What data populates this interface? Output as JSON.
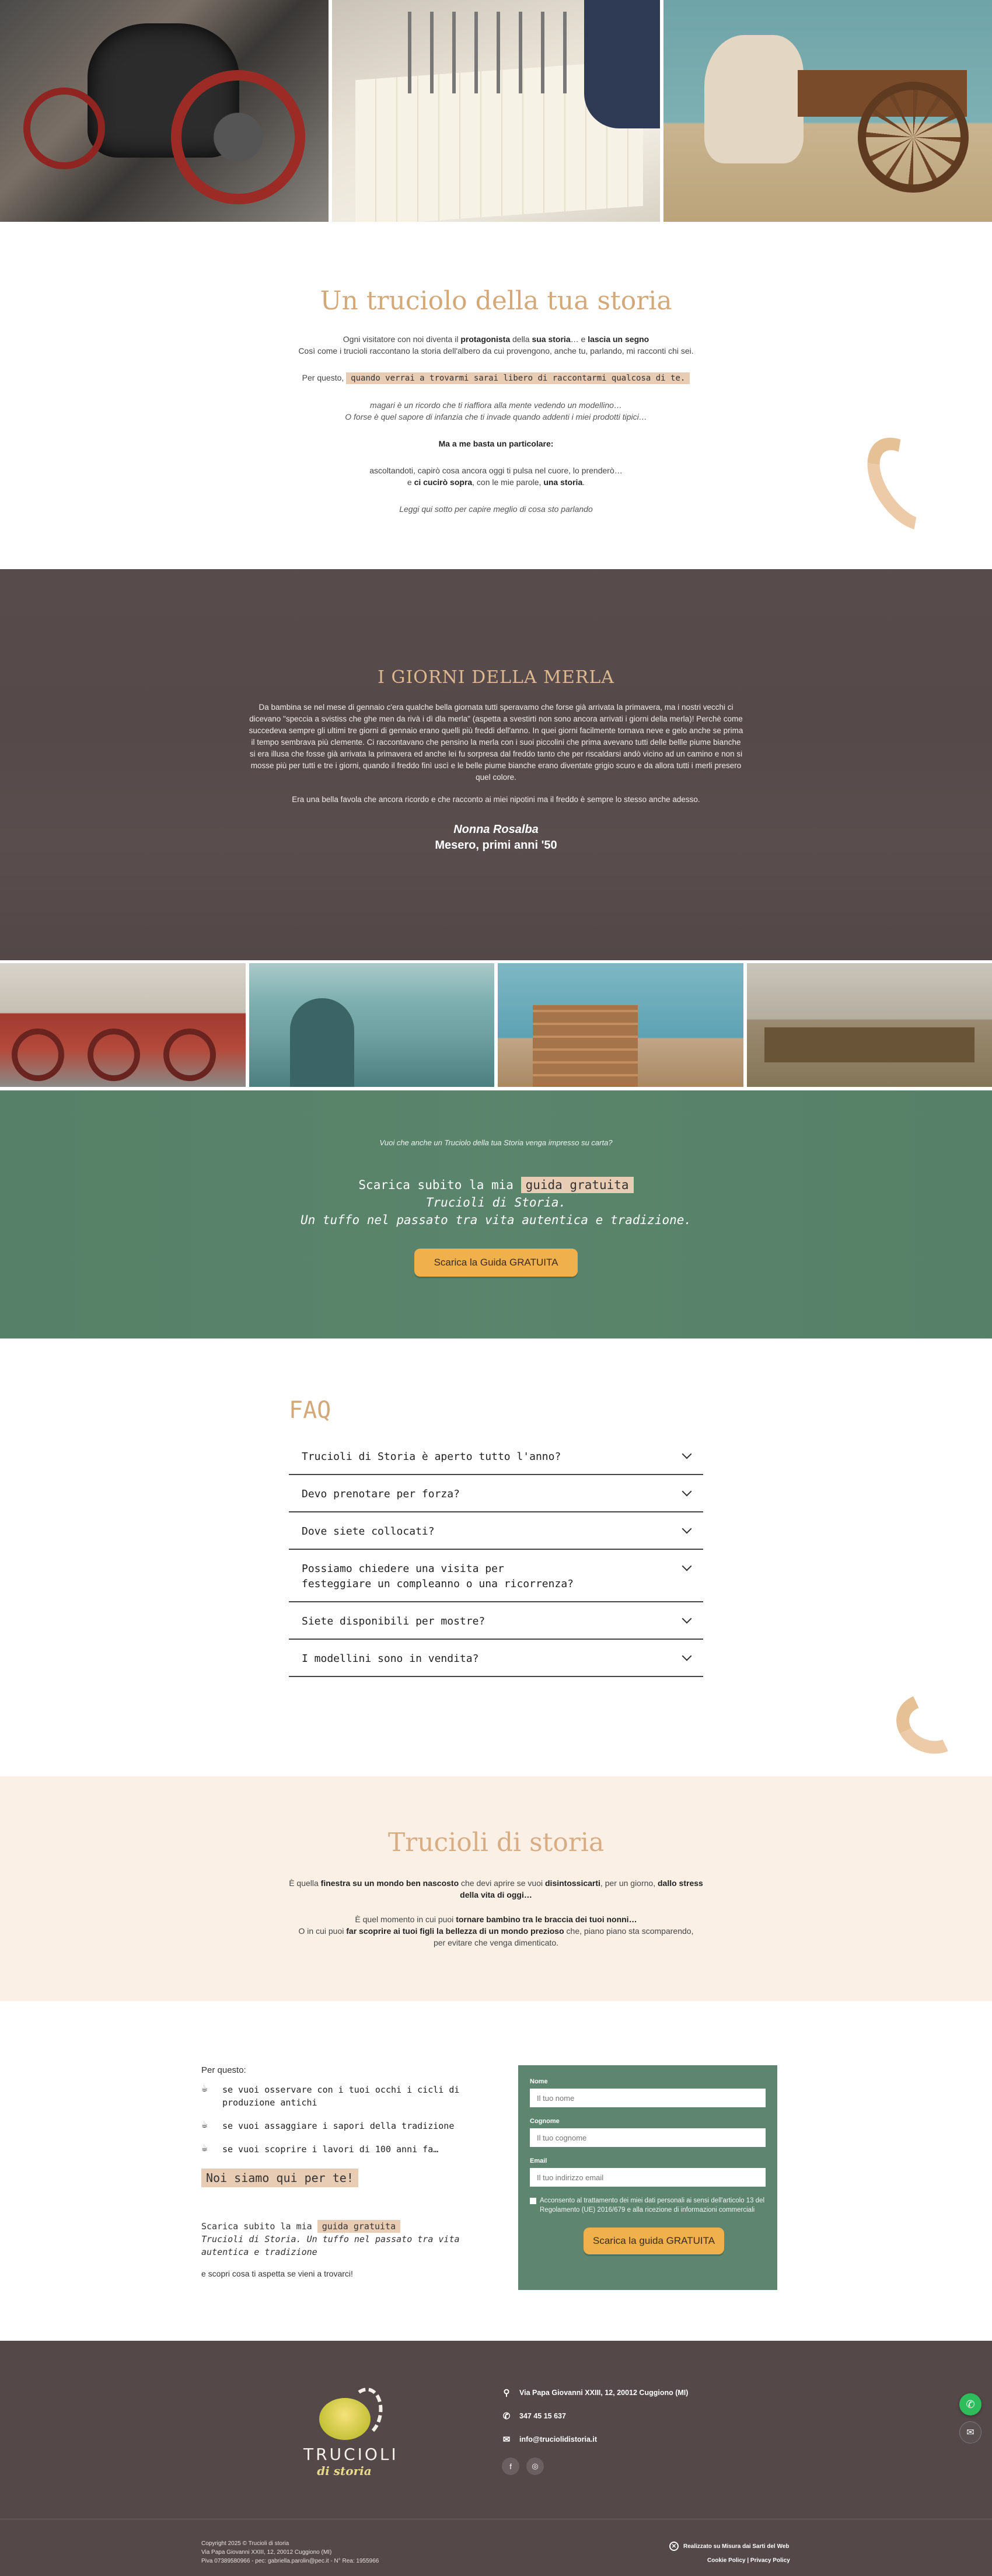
{
  "intro": {
    "title": "Un truciolo della tua storia",
    "line1_a": "Ogni visitatore con noi diventa il ",
    "line1_b": "protagonista",
    "line1_c": " della ",
    "line1_d": "sua storia",
    "line1_e": "… e ",
    "line1_f": "lascia un segno",
    "line2": "Così come i trucioli raccontano la storia dell'albero da cui provengono, anche tu, parlando, mi racconti chi sei.",
    "line3_a": "Per questo, ",
    "line3_hl": "quando verrai a trovarmi sarai libero di raccontarmi qualcosa di te.",
    "line4": "magari è un ricordo che ti riaffiora alla mente vedendo un modellino…",
    "line5": "O forse è quel sapore di infanzia che ti invade quando addenti i miei prodotti tipici…",
    "line6": "Ma a me basta un particolare:",
    "line7": "ascoltandoti, capirò cosa ancora oggi ti pulsa nel cuore, lo prenderò…",
    "line8_a": "e ",
    "line8_b": "ci cucirò sopra",
    "line8_c": ", con le mie parole, ",
    "line8_d": "una storia",
    "line8_e": ".",
    "line9": "Leggi qui sotto per capire meglio di cosa sto parlando"
  },
  "merla": {
    "title": "I GIORNI DELLA MERLA",
    "body": "Da bambina se nel mese di gennaio c'era qualche bella giornata tutti speravamo che forse già arrivata la primavera, ma i nostri vecchi ci dicevano \"speccia a svistiss che ghe men da rivà i dì dla merla\" (aspetta a svestirti non sono ancora arrivati i giorni della merla)! Perchè come succedeva sempre gli ultimi tre giorni di gennaio erano quelli più freddi dell'anno. In quei giorni facilmente tornava neve e gelo anche se prima il tempo sembrava più clemente. Ci raccontavano che pensino la merla con i suoi piccolini che prima avevano tutti delle bellle piume bianche si era illusa che fosse già arrivata la primavera ed anche lei fu sorpresa dal freddo tanto che per riscaldarsi andò vicino ad un camino e non si mosse più per tutti e tre i giorni, quando il freddo finì uscì e le belle piume bianche erano diventate grigio scuro e da allora tutti i merli presero quel colore.",
    "body2": "Era una bella favola che ancora ricordo e che racconto ai miei nipotini ma il freddo è sempre lo stesso anche adesso.",
    "sign_name": "Nonna Rosalba",
    "sign_place": "Mesero, primi anni '50"
  },
  "guide": {
    "question": "Vuoi che anche un Truciolo della tua Storia venga impresso su carta?",
    "line1_a": "Scarica subito la mia ",
    "line1_hl": "guida gratuita",
    "line2": "Trucioli di Storia.",
    "line3": "Un tuffo nel passato tra vita autentica e tradizione.",
    "button": "Scarica la Guida GRATUITA"
  },
  "faq": {
    "title": "FAQ",
    "items": [
      {
        "q": "Trucioli di Storia è aperto tutto l'anno?"
      },
      {
        "q": "Devo prenotare per forza?"
      },
      {
        "q": "Dove siete collocati?"
      },
      {
        "q": "Possiamo chiedere una visita per festeggiare un compleanno o una ricorrenza?"
      },
      {
        "q": "Siete disponibili per mostre?"
      },
      {
        "q": "I modellini sono in vendita?"
      }
    ]
  },
  "trucioli": {
    "title": "Trucioli di storia",
    "p1_a": "È quella ",
    "p1_b": "finestra su un mondo ben nascosto",
    "p1_c": " che devi aprire se vuoi ",
    "p1_d": "disintossicarti",
    "p1_e": ", per un giorno, ",
    "p1_f": "dallo stress della vita di oggi…",
    "p2_a": "È quel momento in cui puoi ",
    "p2_b": "tornare bambino tra le braccia dei tuoi nonni…",
    "p3_a": "O in cui puoi ",
    "p3_b": "far scoprire ai tuoi figli la bellezza di un mondo prezioso",
    "p3_c": " che, piano piano sta scomparendo,",
    "p4": "per evitare che venga dimenticato."
  },
  "formsec": {
    "per_questo": "Per questo:",
    "bullets": [
      "se vuoi osservare con i tuoi occhi i cicli di produzione antichi",
      "se vuoi assaggiare i sapori della tradizione",
      "se vuoi scoprire i lavori di 100 anni fa…"
    ],
    "siamo": "Noi siamo qui per te!",
    "sc_a": "Scarica subito la mia ",
    "sc_hl": "guida gratuita",
    "sc_2": "Trucioli di Storia. Un tuffo nel passato tra vita autentica e tradizione",
    "scopri": "e scopri cosa ti aspetta se vieni a trovarci!"
  },
  "form": {
    "name_label": "Nome",
    "name_placeholder": "Il tuo nome",
    "surname_label": "Cognome",
    "surname_placeholder": "Il tuo cognome",
    "email_label": "Email",
    "email_placeholder": "Il tuo indirizzo email",
    "consent": "Acconsento al trattamento dei miei dati personali ai sensi dell'articolo 13 del Regolamento (UE) 2016/679 e alla ricezione di informazioni commerciali",
    "button": "Scarica la guida GRATUITA"
  },
  "footer": {
    "logo_top": "TRUCIOLI",
    "logo_bottom": "di storia",
    "address": "Via Papa Giovanni XXIII, 12, 20012 Cuggiono (MI)",
    "phone": "347 45 15 637",
    "email": "info@truciolidistoria.it",
    "copy1": "Copyright 2025 © Trucioli di storia",
    "copy2": "Via Papa Giovanni XXIII, 12, 20012 Cuggiono (MI)",
    "copy3": "Piva 07389580966 - pec: gabriella.parolin@pec.it - N° Rea: 1955966",
    "badge": "Realizzato su Misura dai Sarti del Web",
    "links": "Cookie Policy | Privacy Policy"
  }
}
